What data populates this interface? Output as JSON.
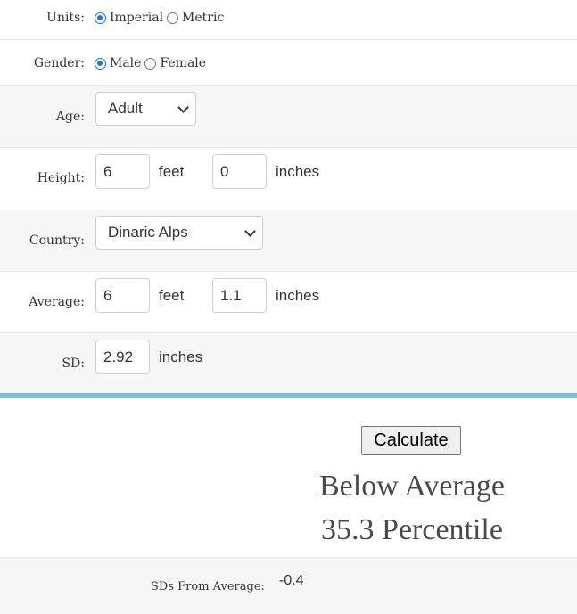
{
  "units": {
    "label": "Units:",
    "options": [
      "Imperial",
      "Metric"
    ],
    "selected": "Imperial"
  },
  "gender": {
    "label": "Gender:",
    "options": [
      "Male",
      "Female"
    ],
    "selected": "Male"
  },
  "age": {
    "label": "Age:",
    "value": "Adult"
  },
  "height": {
    "label": "Height:",
    "feet": "6",
    "feet_unit": "feet",
    "inches": "0",
    "inches_unit": "inches"
  },
  "country": {
    "label": "Country:",
    "value": "Dinaric Alps"
  },
  "average": {
    "label": "Average:",
    "feet": "6",
    "feet_unit": "feet",
    "inches": "1.1",
    "inches_unit": "inches"
  },
  "sd": {
    "label": "SD:",
    "value": "2.92",
    "unit": "inches"
  },
  "calculate_label": "Calculate",
  "result": {
    "category": "Below Average",
    "percentile": "35.3 Percentile"
  },
  "sds_from_average": {
    "label": "SDs From Average:",
    "value": "-0.4"
  },
  "colors": {
    "accent": "#7bbde0",
    "radio": "#1a73e8"
  }
}
